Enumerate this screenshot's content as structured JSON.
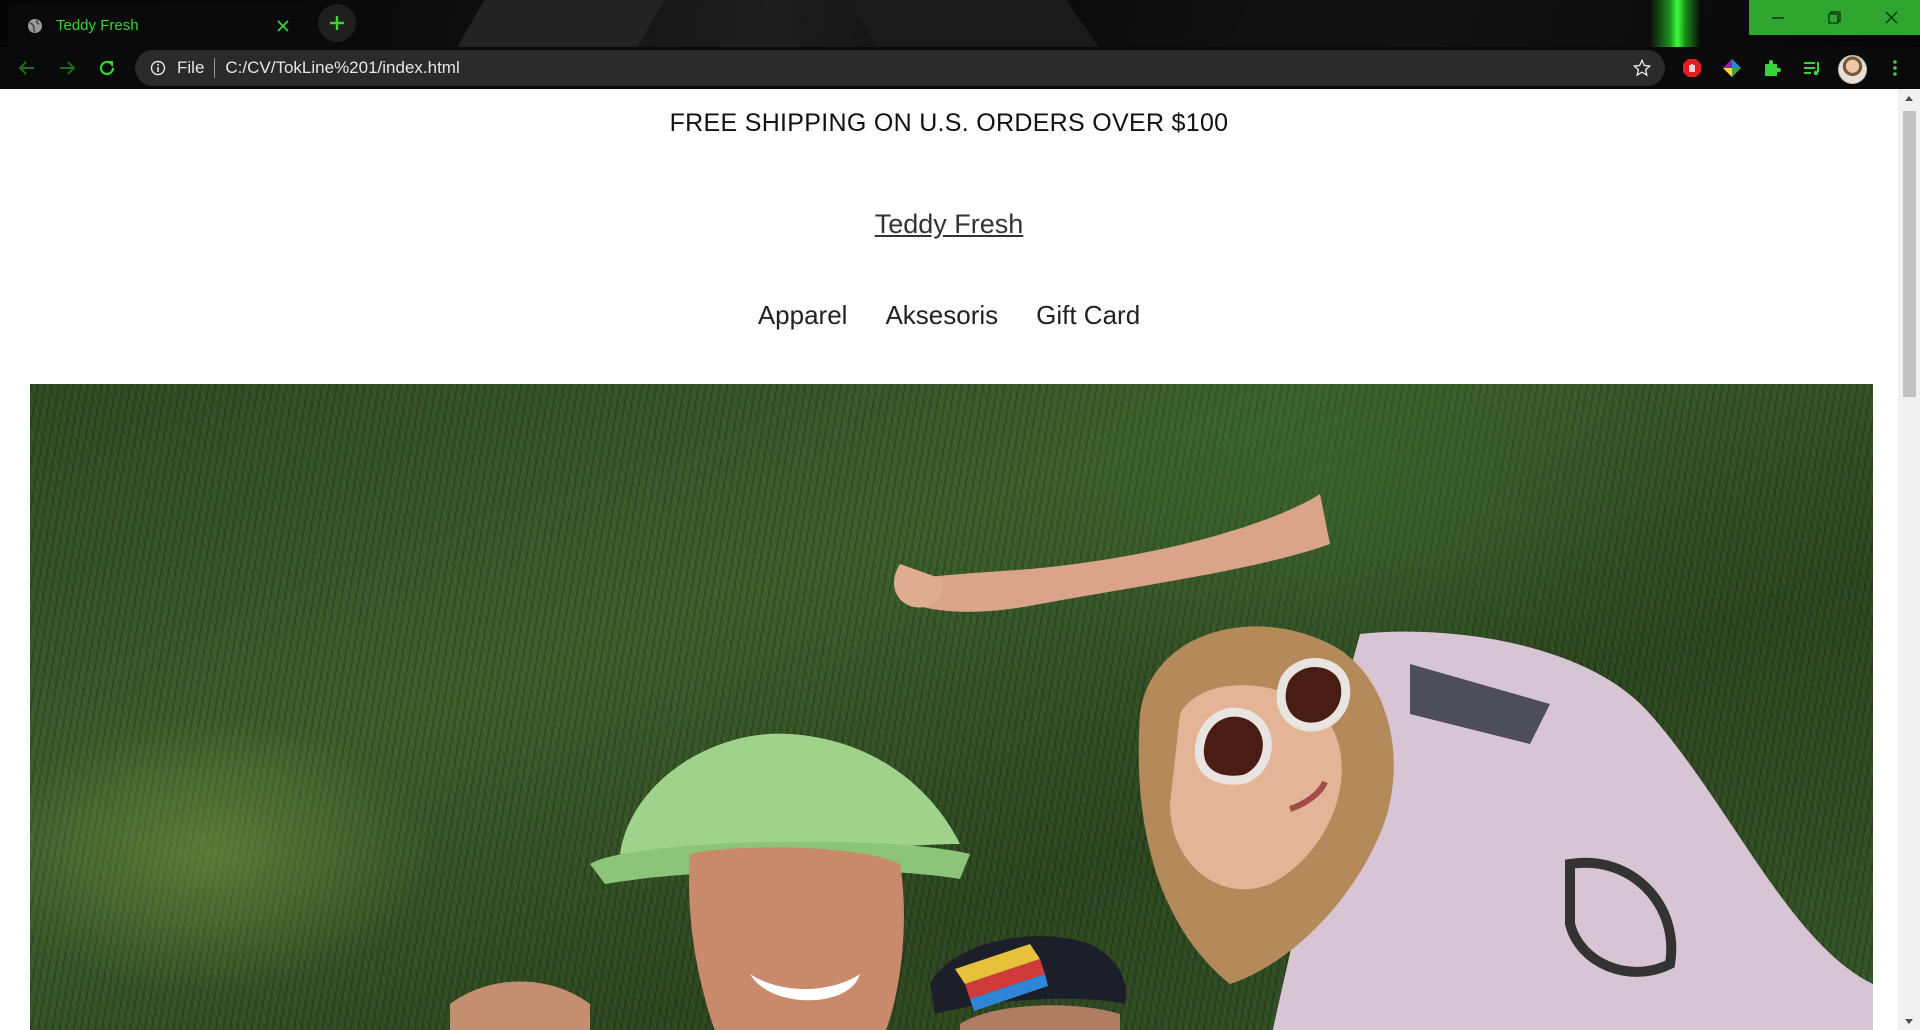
{
  "browser": {
    "tab": {
      "title": "Teddy Fresh",
      "favicon": "globe-icon",
      "close_icon": "close-icon"
    },
    "new_tab_icon": "plus-icon",
    "window_controls": [
      "minimize-icon",
      "maximize-icon",
      "close-icon"
    ],
    "nav": [
      "back-arrow-icon",
      "forward-arrow-icon",
      "reload-icon"
    ],
    "address": {
      "info_icon": "info-icon",
      "scheme": "File",
      "url": "C:/CV/TokLine%201/index.html",
      "bookmark_icon": "star-icon"
    },
    "extensions": [
      "adblock-icon",
      "color-picker-icon",
      "extensions-puzzle-icon",
      "reading-list-icon",
      "profile-avatar",
      "menu-kebab-icon"
    ],
    "accent": "#36d436"
  },
  "page": {
    "announcement": "FREE SHIPPING ON U.S. ORDERS OVER $100",
    "brand": "Teddy Fresh",
    "nav": [
      {
        "label": "Apparel"
      },
      {
        "label": "Aksesoris"
      },
      {
        "label": "Gift Card"
      }
    ],
    "hero": {
      "description_icon": "hero-photo"
    }
  }
}
